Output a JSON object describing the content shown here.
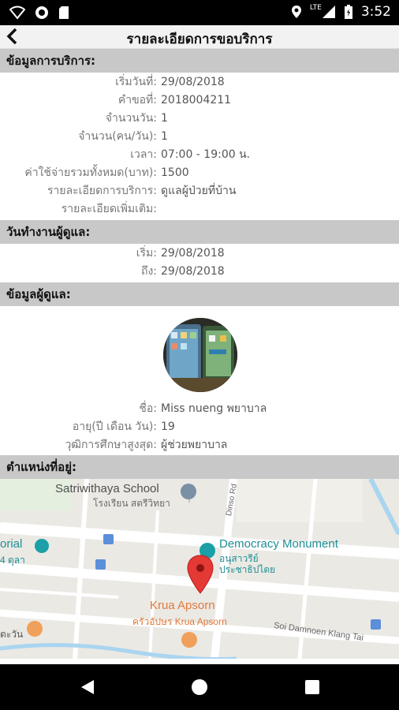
{
  "status_bar": {
    "time": "3:52",
    "network": "LTE"
  },
  "app_bar": {
    "title": "รายละเอียดการขอบริการ"
  },
  "sections": {
    "service_info": "ข้อมูลการบริการ:",
    "work_days": "วันทำงานผู้ดูแล:",
    "caregiver_info": "ข้อมูลผู้ดูแล:",
    "location": "ตำแหน่งที่อยู่:"
  },
  "service_rows": [
    {
      "label": "เริ่มวันที่:",
      "value": "29/08/2018"
    },
    {
      "label": "คำขอที่:",
      "value": "2018004211"
    },
    {
      "label": "จำนวนวัน:",
      "value": "1"
    },
    {
      "label": "จำนวน(คน/วัน):",
      "value": "1"
    },
    {
      "label": "เวลา:",
      "value": "07:00 - 19:00 น."
    },
    {
      "label": "ค่าใช้จ่ายรวมทั้งหมด(บาท):",
      "value": "1500"
    },
    {
      "label": "รายละเอียดการบริการ:",
      "value": "ดูแลผู้ป่วยที่บ้าน"
    },
    {
      "label": "รายละเอียดเพิ่มเติม:",
      "value": ""
    }
  ],
  "work_rows": [
    {
      "label": "เริ่ม:",
      "value": "29/08/2018"
    },
    {
      "label": "ถึง:",
      "value": "29/08/2018"
    }
  ],
  "caregiver_rows": [
    {
      "label": "ชื่อ:",
      "value": "Miss nueng พยาบาล"
    },
    {
      "label": "อายุ(ปี เดือน วัน):",
      "value": "19"
    },
    {
      "label": "วุฒิการศึกษาสูงสุด:",
      "value": "ผู้ช่วยพยาบาล"
    }
  ],
  "map": {
    "school_en": "Satriwithaya School",
    "school_th": "โรงเรียน สตรีวิทยา",
    "road": "Dinso Rd",
    "monument_en": "Democracy Monument",
    "monument_th": "อนุสาวรีย์ ประชาธิปไตย",
    "restaurant_en": "Krua Apsorn",
    "restaurant_th": "ครัวอัปษร Krua Apsorn",
    "memorial_en": "orial",
    "memorial_th": "4 ตุลา",
    "left_th": "ตะวัน",
    "street": "Soi Damnoen Klang Tai"
  }
}
